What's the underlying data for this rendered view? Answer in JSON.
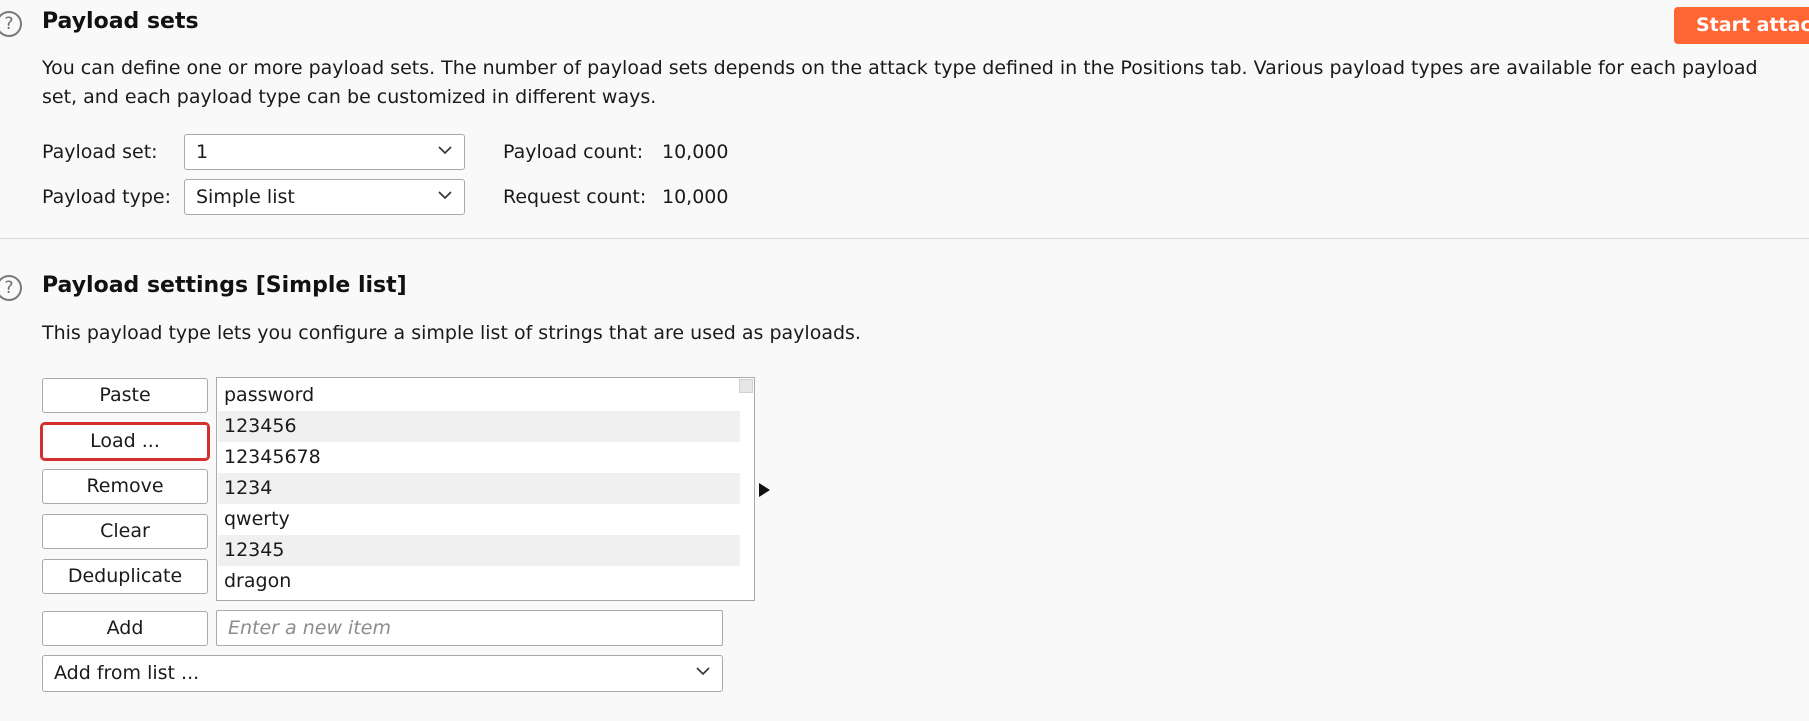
{
  "payload_sets": {
    "title": "Payload sets",
    "description": "You can define one or more payload sets. The number of payload sets depends on the attack type defined in the Positions tab. Various payload types are available for each payload set, and each payload type can be customized in different ways.",
    "start_attack_label": "Start attac",
    "payload_set_label": "Payload set:",
    "payload_set_value": "1",
    "payload_type_label": "Payload type:",
    "payload_type_value": "Simple list",
    "payload_count_label": "Payload count:",
    "payload_count_value": "10,000",
    "request_count_label": "Request count:",
    "request_count_value": "10,000"
  },
  "payload_settings": {
    "title": "Payload settings [Simple list]",
    "description": "This payload type lets you configure a simple list of strings that are used as payloads.",
    "buttons": {
      "paste": "Paste",
      "load": "Load ...",
      "remove": "Remove",
      "clear": "Clear",
      "deduplicate": "Deduplicate",
      "add": "Add"
    },
    "items": [
      "password",
      "123456",
      "12345678",
      "1234",
      "qwerty",
      "12345",
      "dragon"
    ],
    "add_placeholder": "Enter a new item",
    "add_from_list_label": "Add from list ..."
  },
  "icons": {
    "help": "help-icon",
    "chevron": "chevron-down-icon",
    "expand": "expand-arrow-icon"
  },
  "colors": {
    "accent": "#ff6633",
    "focus": "#d32f2f",
    "background": "#f9f9f9"
  }
}
